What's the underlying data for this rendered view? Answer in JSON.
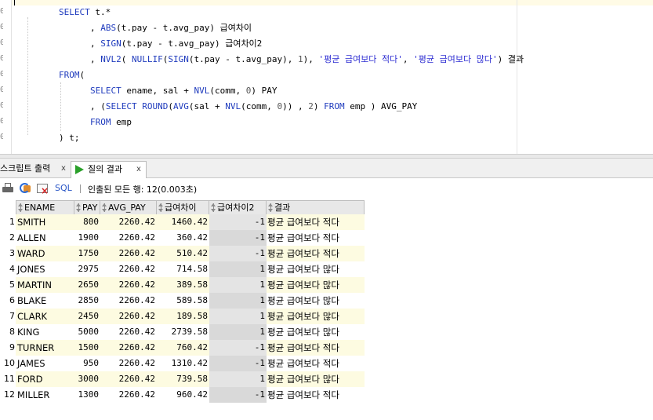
{
  "editor": {
    "line_numbers": [
      "0",
      "0",
      "0",
      "0",
      "0",
      "0",
      "0",
      "0",
      "0"
    ],
    "lines": [
      {
        "indent": "",
        "tokens": [
          [
            "kw",
            "SELECT"
          ],
          [
            "t",
            " t.*"
          ]
        ]
      },
      {
        "indent": "    ",
        "tokens": [
          [
            "t",
            ", "
          ],
          [
            "kw",
            "ABS"
          ],
          [
            "t",
            "(t.pay - t.avg_pay) 급여차이"
          ]
        ]
      },
      {
        "indent": "    ",
        "tokens": [
          [
            "t",
            ", "
          ],
          [
            "kw",
            "SIGN"
          ],
          [
            "t",
            "(t.pay - t.avg_pay) 급여차이2"
          ]
        ]
      },
      {
        "indent": "    ",
        "tokens": [
          [
            "t",
            ", "
          ],
          [
            "kw",
            "NVL2"
          ],
          [
            "t",
            "( "
          ],
          [
            "kw",
            "NULLIF"
          ],
          [
            "t",
            "("
          ],
          [
            "kw",
            "SIGN"
          ],
          [
            "t",
            "(t.pay - t.avg_pay), "
          ],
          [
            "num",
            "1"
          ],
          [
            "t",
            "), "
          ],
          [
            "str",
            "'평균 급여보다 적다'"
          ],
          [
            "t",
            ", "
          ],
          [
            "str",
            "'평균 급여보다 많다'"
          ],
          [
            "t",
            ") 결과"
          ]
        ]
      },
      {
        "indent": "",
        "tokens": [
          [
            "kw",
            "FROM"
          ],
          [
            "t",
            "("
          ]
        ]
      },
      {
        "indent": "    ",
        "tokens": [
          [
            "kw",
            "SELECT"
          ],
          [
            "t",
            " ename, sal + "
          ],
          [
            "kw",
            "NVL"
          ],
          [
            "t",
            "(comm, "
          ],
          [
            "num",
            "0"
          ],
          [
            "t",
            ") PAY"
          ]
        ]
      },
      {
        "indent": "    ",
        "tokens": [
          [
            "t",
            ", ("
          ],
          [
            "kw",
            "SELECT"
          ],
          [
            "t",
            " "
          ],
          [
            "kw",
            "ROUND"
          ],
          [
            "t",
            "("
          ],
          [
            "kw",
            "AVG"
          ],
          [
            "t",
            "(sal + "
          ],
          [
            "kw",
            "NVL"
          ],
          [
            "t",
            "(comm, "
          ],
          [
            "num",
            "0"
          ],
          [
            "t",
            ")) , "
          ],
          [
            "num",
            "2"
          ],
          [
            "t",
            ") "
          ],
          [
            "kw",
            "FROM"
          ],
          [
            "t",
            " emp ) AVG_PAY"
          ]
        ]
      },
      {
        "indent": "    ",
        "tokens": [
          [
            "kw",
            "FROM"
          ],
          [
            "t",
            " emp"
          ]
        ]
      },
      {
        "indent": "",
        "tokens": [
          [
            "t",
            ") t;"
          ]
        ]
      }
    ]
  },
  "tabs": [
    {
      "label": "스크립트 출력",
      "close": "x",
      "active": false
    },
    {
      "label": "질의 결과",
      "close": "x",
      "active": true
    }
  ],
  "toolbar": {
    "icons": [
      "print-icon",
      "refresh-icon",
      "cancel-icon"
    ],
    "sql_label": "SQL",
    "status": "인출된 모든 행: 12(0.003초)"
  },
  "grid": {
    "columns": [
      "ENAME",
      "PAY",
      "AVG_PAY",
      "급여차이",
      "급여차이2",
      "결과"
    ],
    "rows": [
      [
        "1",
        "SMITH",
        "800",
        "2260.42",
        "1460.42",
        "-1",
        "평균 급여보다 적다"
      ],
      [
        "2",
        "ALLEN",
        "1900",
        "2260.42",
        "360.42",
        "-1",
        "평균 급여보다 적다"
      ],
      [
        "3",
        "WARD",
        "1750",
        "2260.42",
        "510.42",
        "-1",
        "평균 급여보다 적다"
      ],
      [
        "4",
        "JONES",
        "2975",
        "2260.42",
        "714.58",
        "1",
        "평균 급여보다 많다"
      ],
      [
        "5",
        "MARTIN",
        "2650",
        "2260.42",
        "389.58",
        "1",
        "평균 급여보다 많다"
      ],
      [
        "6",
        "BLAKE",
        "2850",
        "2260.42",
        "589.58",
        "1",
        "평균 급여보다 많다"
      ],
      [
        "7",
        "CLARK",
        "2450",
        "2260.42",
        "189.58",
        "1",
        "평균 급여보다 많다"
      ],
      [
        "8",
        "KING",
        "5000",
        "2260.42",
        "2739.58",
        "1",
        "평균 급여보다 많다"
      ],
      [
        "9",
        "TURNER",
        "1500",
        "2260.42",
        "760.42",
        "-1",
        "평균 급여보다 적다"
      ],
      [
        "10",
        "JAMES",
        "950",
        "2260.42",
        "1310.42",
        "-1",
        "평균 급여보다 적다"
      ],
      [
        "11",
        "FORD",
        "3000",
        "2260.42",
        "739.58",
        "1",
        "평균 급여보다 많다"
      ],
      [
        "12",
        "MILLER",
        "1300",
        "2260.42",
        "960.42",
        "-1",
        "평균 급여보다 적다"
      ]
    ]
  },
  "colors": {
    "keyword": "#1f3bbd",
    "string": "#2d2dd2",
    "row_odd": "#fdfbe1",
    "row_even": "#ffffff",
    "selected_col_odd": "#e4e4e4",
    "selected_col_even": "#d9d9d9"
  }
}
